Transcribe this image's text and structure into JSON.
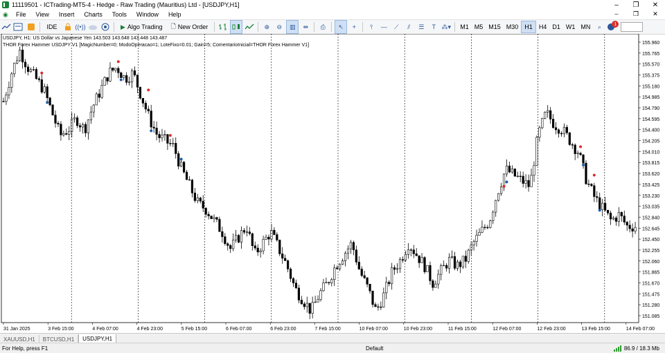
{
  "window": {
    "title": "11119501 - ICTrading-MT5-4 - Hedge - Raw Trading (Mauritius) Ltd - [USDJPY,H1]",
    "controls": [
      "–",
      "❐",
      "✕"
    ]
  },
  "menu": {
    "items": [
      "File",
      "View",
      "Insert",
      "Charts",
      "Tools",
      "Window",
      "Help"
    ],
    "mdi_controls": [
      "–",
      "❐",
      "✕"
    ]
  },
  "toolbar": {
    "ide_label": "IDE",
    "algo_trading_label": "Algo Trading",
    "new_order_label": "New Order",
    "timeframes": [
      "M1",
      "M5",
      "M15",
      "M30",
      "H1",
      "H4",
      "D1",
      "W1",
      "MN"
    ],
    "active_timeframe": "H1",
    "notification_count": "1"
  },
  "chart": {
    "symbol_line": "USDJPY, H1:  US Dollar vs Japanese Yen  143.503 143.648 143.448 143.487",
    "ea_line": "THOR Forex Hammer USDJPY V1 [MagicNumber=0; ModoOperacao=1; LoteFixo=0.01; Gain=5; ComentarioInicial=THOR Forex Hammer V1]",
    "colors": {
      "bull": "#ffffff",
      "bear": "#000000",
      "grid": "#000000",
      "buy_marker": "#1f5fa8",
      "sell_marker": "#d9302c"
    }
  },
  "chart_data": {
    "type": "candlestick",
    "symbol": "USDJPY",
    "timeframe": "H1",
    "ylim": [
      150.9,
      155.99
    ],
    "price_ticks": [
      "155.960",
      "155.765",
      "155.570",
      "155.375",
      "155.180",
      "154.985",
      "154.790",
      "154.595",
      "154.400",
      "154.205",
      "154.010",
      "153.815",
      "153.620",
      "153.425",
      "153.230",
      "153.035",
      "152.840",
      "152.645",
      "152.450",
      "152.255",
      "152.060",
      "151.865",
      "151.670",
      "151.475",
      "151.280",
      "151.085"
    ],
    "time_ticks": [
      "31 Jan 2025",
      "3 Feb 15:00",
      "4 Feb 07:00",
      "4 Feb 23:00",
      "5 Feb 15:00",
      "6 Feb 07:00",
      "6 Feb 23:00",
      "7 Feb 15:00",
      "10 Feb 07:00",
      "10 Feb 23:00",
      "11 Feb 15:00",
      "12 Feb 07:00",
      "12 Feb 23:00",
      "13 Feb 15:00",
      "14 Feb 07:00"
    ],
    "close_path": [
      154.8,
      155.3,
      155.7,
      155.4,
      155.2,
      155.0,
      154.6,
      154.2,
      154.3,
      154.5,
      154.3,
      154.7,
      155.0,
      155.3,
      155.4,
      155.2,
      155.3,
      154.9,
      154.5,
      154.2,
      154.1,
      154.0,
      153.6,
      153.3,
      153.0,
      152.9,
      152.7,
      152.5,
      152.2,
      152.4,
      152.6,
      152.1,
      152.3,
      152.5,
      152.2,
      151.9,
      151.5,
      151.3,
      151.1,
      151.4,
      151.6,
      151.9,
      152.1,
      152.3,
      151.8,
      151.5,
      151.1,
      151.4,
      151.8,
      152.0,
      152.3,
      152.1,
      151.9,
      151.6,
      151.8,
      152.0,
      151.9,
      152.0,
      152.3,
      152.5,
      152.7,
      153.2,
      153.6,
      153.5,
      153.4,
      153.3,
      154.2,
      154.6,
      154.4,
      154.3,
      154.1,
      153.9,
      153.4,
      153.1,
      152.9,
      152.7,
      152.8,
      152.6,
      152.6
    ]
  },
  "tabs": [
    "XAUUSD,H1",
    "BTCUSD,H1",
    "USDJPY,H1"
  ],
  "active_tab": "USDJPY,H1",
  "status": {
    "help": "For Help, press F1",
    "profile": "Default",
    "traffic": "86.9 / 18.3 Mb"
  }
}
